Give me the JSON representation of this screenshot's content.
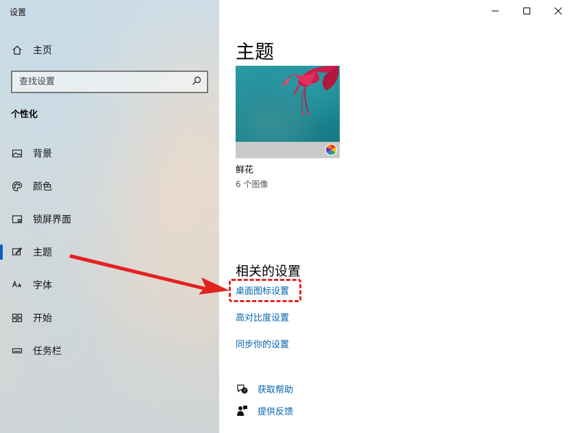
{
  "window": {
    "title": "设置"
  },
  "sidebar": {
    "home_label": "主页",
    "search_placeholder": "查找设置",
    "section_title": "个性化",
    "items": [
      {
        "label": "背景",
        "icon": "picture-icon"
      },
      {
        "label": "颜色",
        "icon": "palette-icon"
      },
      {
        "label": "锁屏界面",
        "icon": "lock-screen-icon"
      },
      {
        "label": "主题",
        "icon": "theme-brush-icon",
        "active": true
      },
      {
        "label": "字体",
        "icon": "font-icon"
      },
      {
        "label": "开始",
        "icon": "start-grid-icon"
      },
      {
        "label": "任务栏",
        "icon": "taskbar-icon"
      }
    ]
  },
  "main": {
    "title": "主题",
    "theme": {
      "name": "鲜花",
      "count": "6 个图像"
    },
    "related_title": "相关的设置",
    "links": {
      "desktop_icons": "桌面图标设置",
      "high_contrast": "高对比度设置",
      "sync": "同步你的设置"
    },
    "help": {
      "get_help": "获取帮助",
      "feedback": "提供反馈"
    }
  },
  "colors": {
    "accent": "#0063b1",
    "annotation": "#e3211f"
  }
}
